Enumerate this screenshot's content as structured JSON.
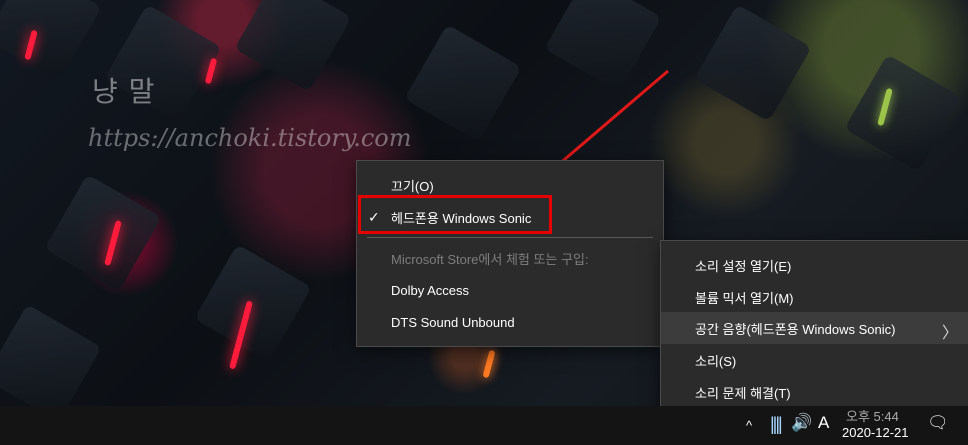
{
  "watermark": {
    "name": "냥 말",
    "url": "https://anchoki.tistory.com"
  },
  "spatial_menu": {
    "items": [
      {
        "label": "끄기(O)",
        "checked": false,
        "disabled": false
      },
      {
        "label": "헤드폰용 Windows Sonic",
        "checked": true,
        "disabled": false
      },
      {
        "label": "Microsoft Store에서 체험 또는 구입:",
        "checked": false,
        "disabled": true
      },
      {
        "label": "Dolby Access",
        "checked": false,
        "disabled": false
      },
      {
        "label": "DTS Sound Unbound",
        "checked": false,
        "disabled": false
      }
    ],
    "check_icon": "✓"
  },
  "sound_menu": {
    "items": [
      {
        "label": "소리 설정 열기(E)"
      },
      {
        "label": "볼륨 믹서 열기(M)"
      },
      {
        "label": "공간 음향(헤드폰용 Windows Sonic)",
        "has_submenu": true,
        "selected": true
      },
      {
        "label": "소리(S)"
      },
      {
        "label": "소리 문제 해결(T)"
      }
    ],
    "submenu_icon": "〉"
  },
  "taskbar": {
    "chevron_icon": "^",
    "network_icon": "||||",
    "speaker_icon": "🔊",
    "ime_label": "A",
    "time": "오후 5:44",
    "date": "2020-12-21",
    "notification_icon": "🗨"
  },
  "colors": {
    "menu_bg": "#2b2b2b",
    "accent_red": "#e60000"
  }
}
